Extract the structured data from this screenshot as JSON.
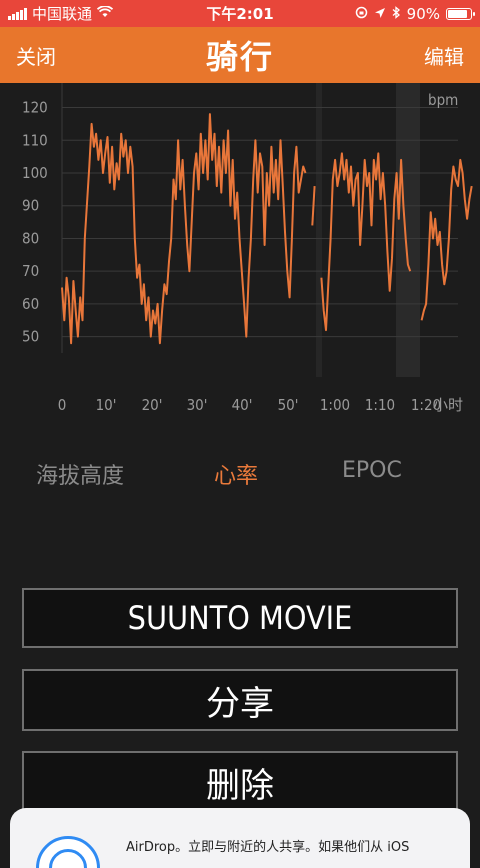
{
  "status_bar": {
    "carrier": "中国联通",
    "time": "下午2:01",
    "battery": "90%",
    "battery_level": 0.9
  },
  "nav": {
    "close_label": "关闭",
    "title": "骑行",
    "edit_label": "编辑"
  },
  "chart_data": {
    "type": "line",
    "y_ticks": [
      "120",
      "110",
      "100",
      "90",
      "80",
      "70",
      "60",
      "50"
    ],
    "y_unit": "bpm",
    "x_ticks": [
      "0",
      "10'",
      "20'",
      "30'",
      "40'",
      "50'",
      "1:00",
      "1:10",
      "1:20",
      "小时"
    ],
    "ylim": [
      45,
      122
    ],
    "xlim": [
      0,
      87
    ],
    "grid": true,
    "series": [
      {
        "color": "#e8763a",
        "segments": [
          [
            [
              0,
              65
            ],
            [
              0.5,
              55
            ],
            [
              1,
              68
            ],
            [
              1.5,
              62
            ],
            [
              2,
              48
            ],
            [
              2.5,
              67
            ],
            [
              3,
              58
            ],
            [
              3.5,
              50
            ],
            [
              4,
              62
            ],
            [
              4.5,
              55
            ],
            [
              5,
              80
            ],
            [
              6,
              102
            ],
            [
              6.5,
              115
            ],
            [
              7,
              108
            ],
            [
              7.5,
              112
            ],
            [
              8,
              104
            ],
            [
              8.5,
              110
            ],
            [
              9,
              100
            ],
            [
              9.5,
              106
            ],
            [
              10,
              111
            ],
            [
              10.5,
              97
            ],
            [
              11,
              108
            ],
            [
              11.5,
              95
            ],
            [
              12,
              103
            ],
            [
              12.5,
              98
            ],
            [
              13,
              112
            ],
            [
              13.5,
              105
            ],
            [
              14,
              110
            ],
            [
              14.5,
              100
            ],
            [
              15,
              108
            ],
            [
              15.5,
              102
            ],
            [
              16,
              80
            ],
            [
              16.5,
              68
            ],
            [
              17,
              72
            ],
            [
              17.5,
              60
            ],
            [
              18,
              66
            ],
            [
              18.5,
              55
            ],
            [
              19,
              62
            ],
            [
              19.5,
              50
            ],
            [
              20,
              58
            ],
            [
              20.5,
              54
            ],
            [
              21,
              60
            ],
            [
              21.5,
              48
            ],
            [
              22,
              58
            ],
            [
              22.5,
              66
            ],
            [
              23,
              63
            ],
            [
              23.5,
              73
            ],
            [
              24,
              80
            ],
            [
              24.5,
              98
            ],
            [
              25,
              92
            ],
            [
              25.5,
              110
            ],
            [
              26,
              95
            ],
            [
              26.5,
              104
            ],
            [
              27,
              90
            ],
            [
              27.5,
              78
            ],
            [
              28,
              70
            ],
            [
              28.5,
              85
            ],
            [
              29,
              100
            ],
            [
              29.5,
              106
            ],
            [
              30,
              95
            ],
            [
              30.5,
              112
            ],
            [
              31,
              100
            ],
            [
              31.5,
              110
            ],
            [
              32,
              98
            ],
            [
              32.5,
              118
            ],
            [
              33,
              104
            ],
            [
              33.5,
              112
            ],
            [
              34,
              96
            ],
            [
              34.5,
              108
            ],
            [
              35,
              94
            ],
            [
              35.5,
              110
            ],
            [
              36,
              100
            ],
            [
              36.5,
              113
            ],
            [
              37,
              90
            ],
            [
              37.5,
              104
            ],
            [
              38,
              86
            ],
            [
              38.5,
              94
            ],
            [
              39,
              80
            ],
            [
              39.5,
              70
            ],
            [
              40,
              60
            ],
            [
              40.5,
              50
            ],
            [
              41,
              68
            ],
            [
              41.5,
              80
            ],
            [
              42,
              98
            ],
            [
              42.5,
              110
            ],
            [
              43,
              94
            ],
            [
              43.5,
              106
            ],
            [
              44,
              102
            ],
            [
              44.5,
              78
            ],
            [
              45,
              100
            ],
            [
              45.5,
              90
            ],
            [
              46,
              108
            ],
            [
              46.5,
              94
            ],
            [
              47,
              104
            ],
            [
              47.5,
              92
            ],
            [
              48,
              110
            ],
            [
              48.5,
              96
            ],
            [
              49,
              82
            ],
            [
              49.5,
              70
            ],
            [
              50,
              62
            ],
            [
              50.5,
              80
            ],
            [
              51,
              100
            ],
            [
              51.5,
              108
            ],
            [
              52,
              94
            ],
            [
              52.5,
              98
            ],
            [
              53,
              102
            ],
            [
              53.5,
              100
            ]
          ],
          [
            [
              55,
              84
            ],
            [
              55.5,
              96
            ]
          ],
          [
            [
              57,
              68
            ],
            [
              57.5,
              58
            ],
            [
              58,
              52
            ],
            [
              58.5,
              66
            ],
            [
              59,
              80
            ],
            [
              59.5,
              98
            ],
            [
              60,
              104
            ],
            [
              60.5,
              96
            ],
            [
              61,
              100
            ],
            [
              61.5,
              106
            ],
            [
              62,
              98
            ],
            [
              62.5,
              104
            ],
            [
              63,
              94
            ],
            [
              63.5,
              102
            ],
            [
              64,
              90
            ],
            [
              64.5,
              98
            ],
            [
              65,
              100
            ],
            [
              65.5,
              78
            ],
            [
              66,
              90
            ],
            [
              66.5,
              104
            ],
            [
              67,
              96
            ],
            [
              67.5,
              100
            ],
            [
              68,
              84
            ],
            [
              68.5,
              104
            ],
            [
              69,
              98
            ],
            [
              69.5,
              106
            ],
            [
              70,
              92
            ],
            [
              70.5,
              100
            ],
            [
              71,
              90
            ],
            [
              71.5,
              76
            ],
            [
              72,
              64
            ],
            [
              72.5,
              74
            ],
            [
              73,
              92
            ],
            [
              73.5,
              100
            ],
            [
              74,
              86
            ],
            [
              74.5,
              104
            ],
            [
              75,
              90
            ],
            [
              75.5,
              80
            ],
            [
              76,
              72
            ],
            [
              76.5,
              70
            ]
          ],
          [
            [
              79,
              55
            ],
            [
              79.5,
              58
            ],
            [
              80,
              60
            ],
            [
              80.5,
              72
            ],
            [
              81,
              88
            ],
            [
              81.5,
              80
            ],
            [
              82,
              86
            ],
            [
              82.5,
              78
            ],
            [
              83,
              82
            ],
            [
              83.5,
              72
            ],
            [
              84,
              66
            ],
            [
              84.5,
              70
            ],
            [
              85,
              80
            ],
            [
              85.5,
              95
            ],
            [
              86,
              102
            ],
            [
              86.5,
              98
            ],
            [
              87,
              96
            ],
            [
              87.5,
              104
            ],
            [
              88,
              100
            ],
            [
              88.5,
              92
            ],
            [
              89,
              86
            ],
            [
              89.5,
              92
            ],
            [
              90,
              96
            ]
          ]
        ]
      }
    ]
  },
  "tabs": [
    {
      "label": "海拔高度",
      "active": false
    },
    {
      "label": "心率",
      "active": true
    },
    {
      "label": "EPOC",
      "active": false
    }
  ],
  "actions": {
    "movie_label": "SUUNTO MOVIE",
    "share_label": "分享",
    "delete_label": "删除"
  },
  "share_sheet": {
    "airdrop_text": "AirDrop。立即与附近的人共享。如果他们从 iOS"
  }
}
